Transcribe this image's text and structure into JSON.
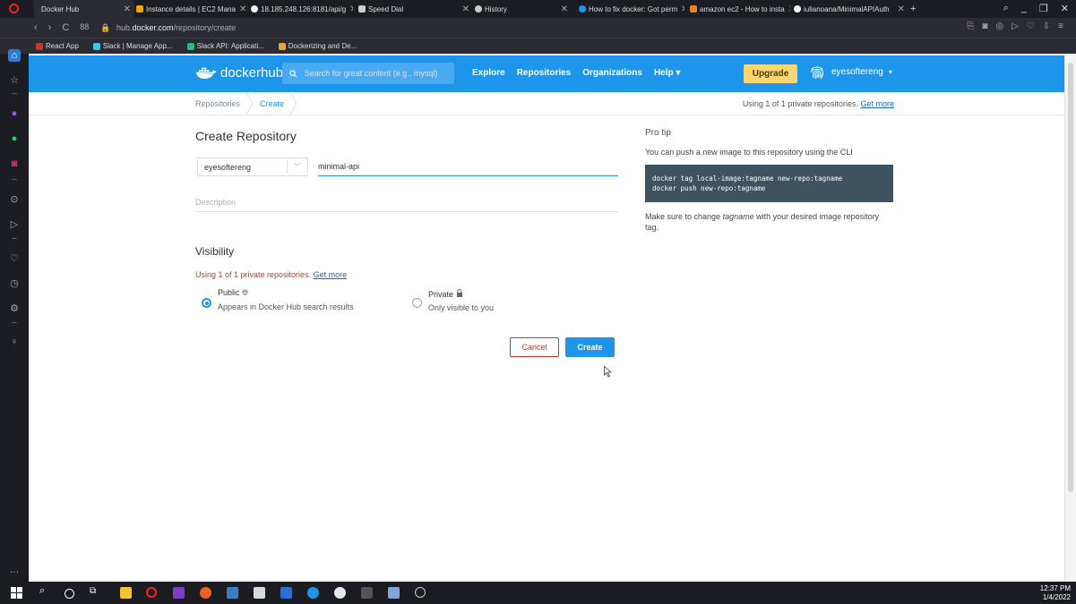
{
  "browser": {
    "tabs": [
      {
        "title": "Docker Hub",
        "color": "#1d95ea"
      },
      {
        "title": "Instance details | EC2 Mana",
        "color": "#f0a500"
      },
      {
        "title": "18.185.248.126:8181/api/g",
        "color": "#ffffff"
      },
      {
        "title": "Speed Dial",
        "color": "#cccccc"
      },
      {
        "title": "History",
        "color": "#cccccc"
      },
      {
        "title": "How to fix docker: Got perm",
        "color": "#1d95ea"
      },
      {
        "title": "amazon ec2 - How to insta",
        "color": "#f48024"
      },
      {
        "title": "iulianoana/MinimalAPIAuth",
        "color": "#ffffff"
      }
    ],
    "url_prefix": "hub.",
    "url_domain": "docker.com",
    "url_path": "/repository/create",
    "bookmarks": [
      "React App",
      "Slack | Manage App...",
      "Slack API: Applicati...",
      "Dockerizing and De..."
    ]
  },
  "hub": {
    "logo_text": "dockerhub",
    "search_placeholder": "Search for great content (e.g., mysql)",
    "nav_links": [
      "Explore",
      "Repositories",
      "Organizations",
      "Help ▾"
    ],
    "upgrade_label": "Upgrade",
    "username": "eyesoftereng",
    "user_caret": "▾"
  },
  "breadcrumb": {
    "items": [
      "Repositories",
      "Create"
    ],
    "usage_text": "Using 1 of 1 private repositories.",
    "usage_link": "Get more"
  },
  "form": {
    "title": "Create Repository",
    "namespace": "eyesoftereng",
    "name_value": "minimal-api",
    "description_placeholder": "Description",
    "visibility_title": "Visibility",
    "visibility_note": "Using 1 of 1 private repositories.",
    "visibility_link": "Get more",
    "public_label": "Public",
    "public_sub": "Appears in Docker Hub search results",
    "private_label": "Private",
    "private_sub": "Only visible to you",
    "selected": "public",
    "cancel_label": "Cancel",
    "create_label": "Create"
  },
  "protip": {
    "title": "Pro tip",
    "text": "You can push a new image to this repository using the CLI",
    "code_line1": "docker tag local-image:tagname new-repo:tagname",
    "code_line2": "docker push new-repo:tagname",
    "after_prefix": "Make sure to change ",
    "after_italic": "tagname",
    "after_suffix": " with your desired image repository tag."
  },
  "taskbar": {
    "time": "12:37 PM",
    "date": "1/4/2022"
  },
  "colors": {
    "accent": "#1d95ea",
    "upgrade": "#fbd56f",
    "danger": "#c0392b",
    "code_bg": "#3e5260"
  }
}
